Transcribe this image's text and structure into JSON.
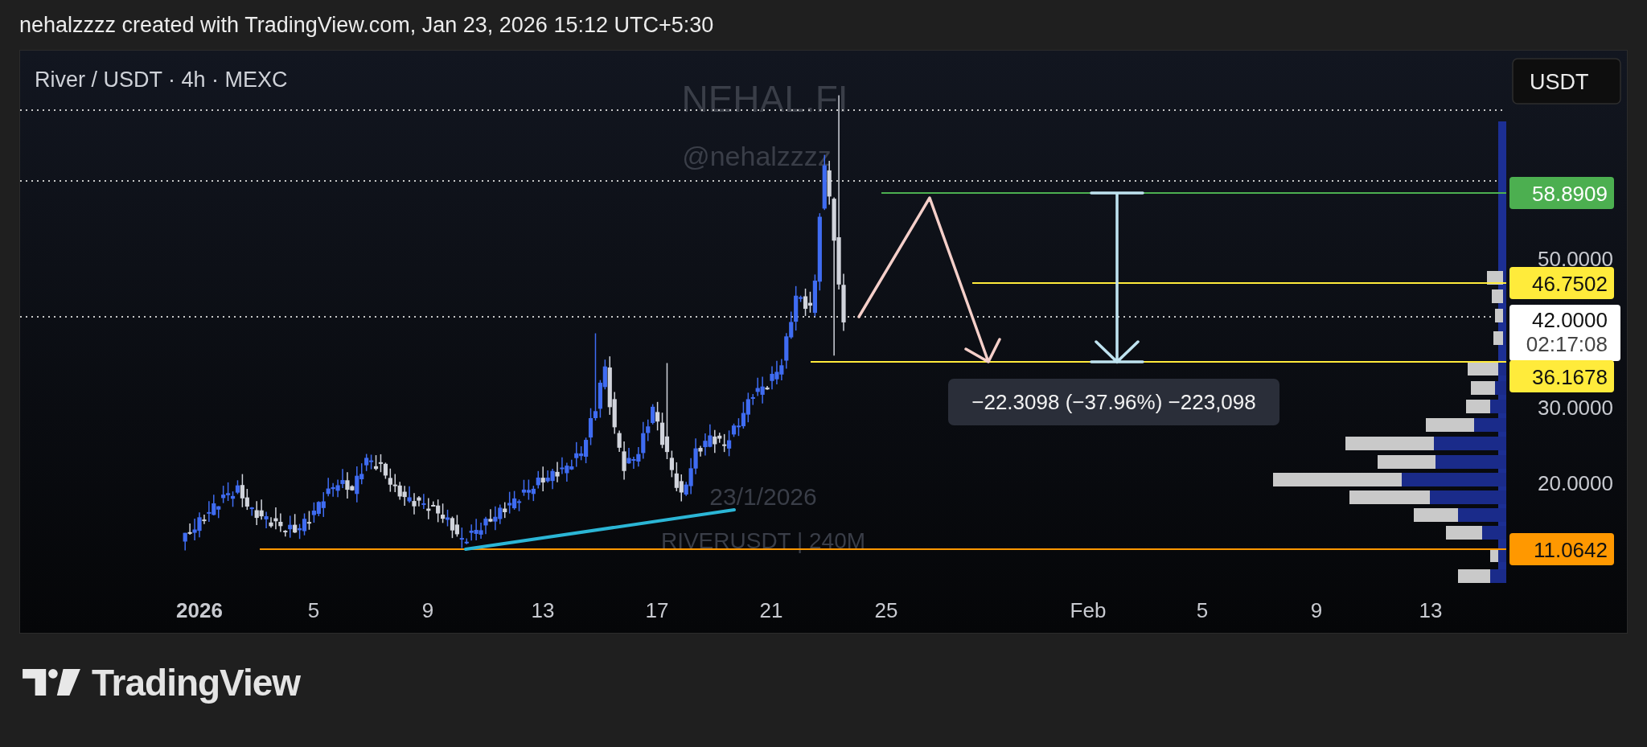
{
  "header": {
    "caption": "nehalzzzz created with TradingView.com, Jan 23, 2026 15:12 UTC+5:30"
  },
  "chart": {
    "symbol": "River / USDT · 4h · MEXC",
    "currency_button": "USDT",
    "watermarks": [
      "NEHAL.FI",
      "@nehalzzzz",
      "23/1/2026",
      "RIVERUSDT | 240M"
    ],
    "price_axis": [
      "50.0000",
      "30.0000",
      "20.0000"
    ],
    "time_axis": [
      {
        "label": "2026",
        "bold": true
      },
      {
        "label": "5",
        "bold": false
      },
      {
        "label": "9",
        "bold": false
      },
      {
        "label": "13",
        "bold": false
      },
      {
        "label": "17",
        "bold": false
      },
      {
        "label": "21",
        "bold": false
      },
      {
        "label": "25",
        "bold": false
      },
      {
        "label": "Feb",
        "bold": false
      },
      {
        "label": "5",
        "bold": false
      },
      {
        "label": "9",
        "bold": false
      },
      {
        "label": "13",
        "bold": false
      }
    ],
    "price_tags": [
      {
        "kind": "level",
        "text": "58.8909",
        "color": "#4caf50"
      },
      {
        "kind": "level",
        "text": "46.7502",
        "color": "#ffeb3b"
      },
      {
        "kind": "current",
        "text": "42.0000",
        "countdown": "02:17:08"
      },
      {
        "kind": "level",
        "text": "36.1678",
        "color": "#ffeb3b"
      },
      {
        "kind": "level",
        "text": "11.0642",
        "color": "#ff9800"
      }
    ],
    "measure_label": "−22.3098 (−37.96%) −223,098"
  },
  "footer": {
    "brand": "TradingView"
  }
}
